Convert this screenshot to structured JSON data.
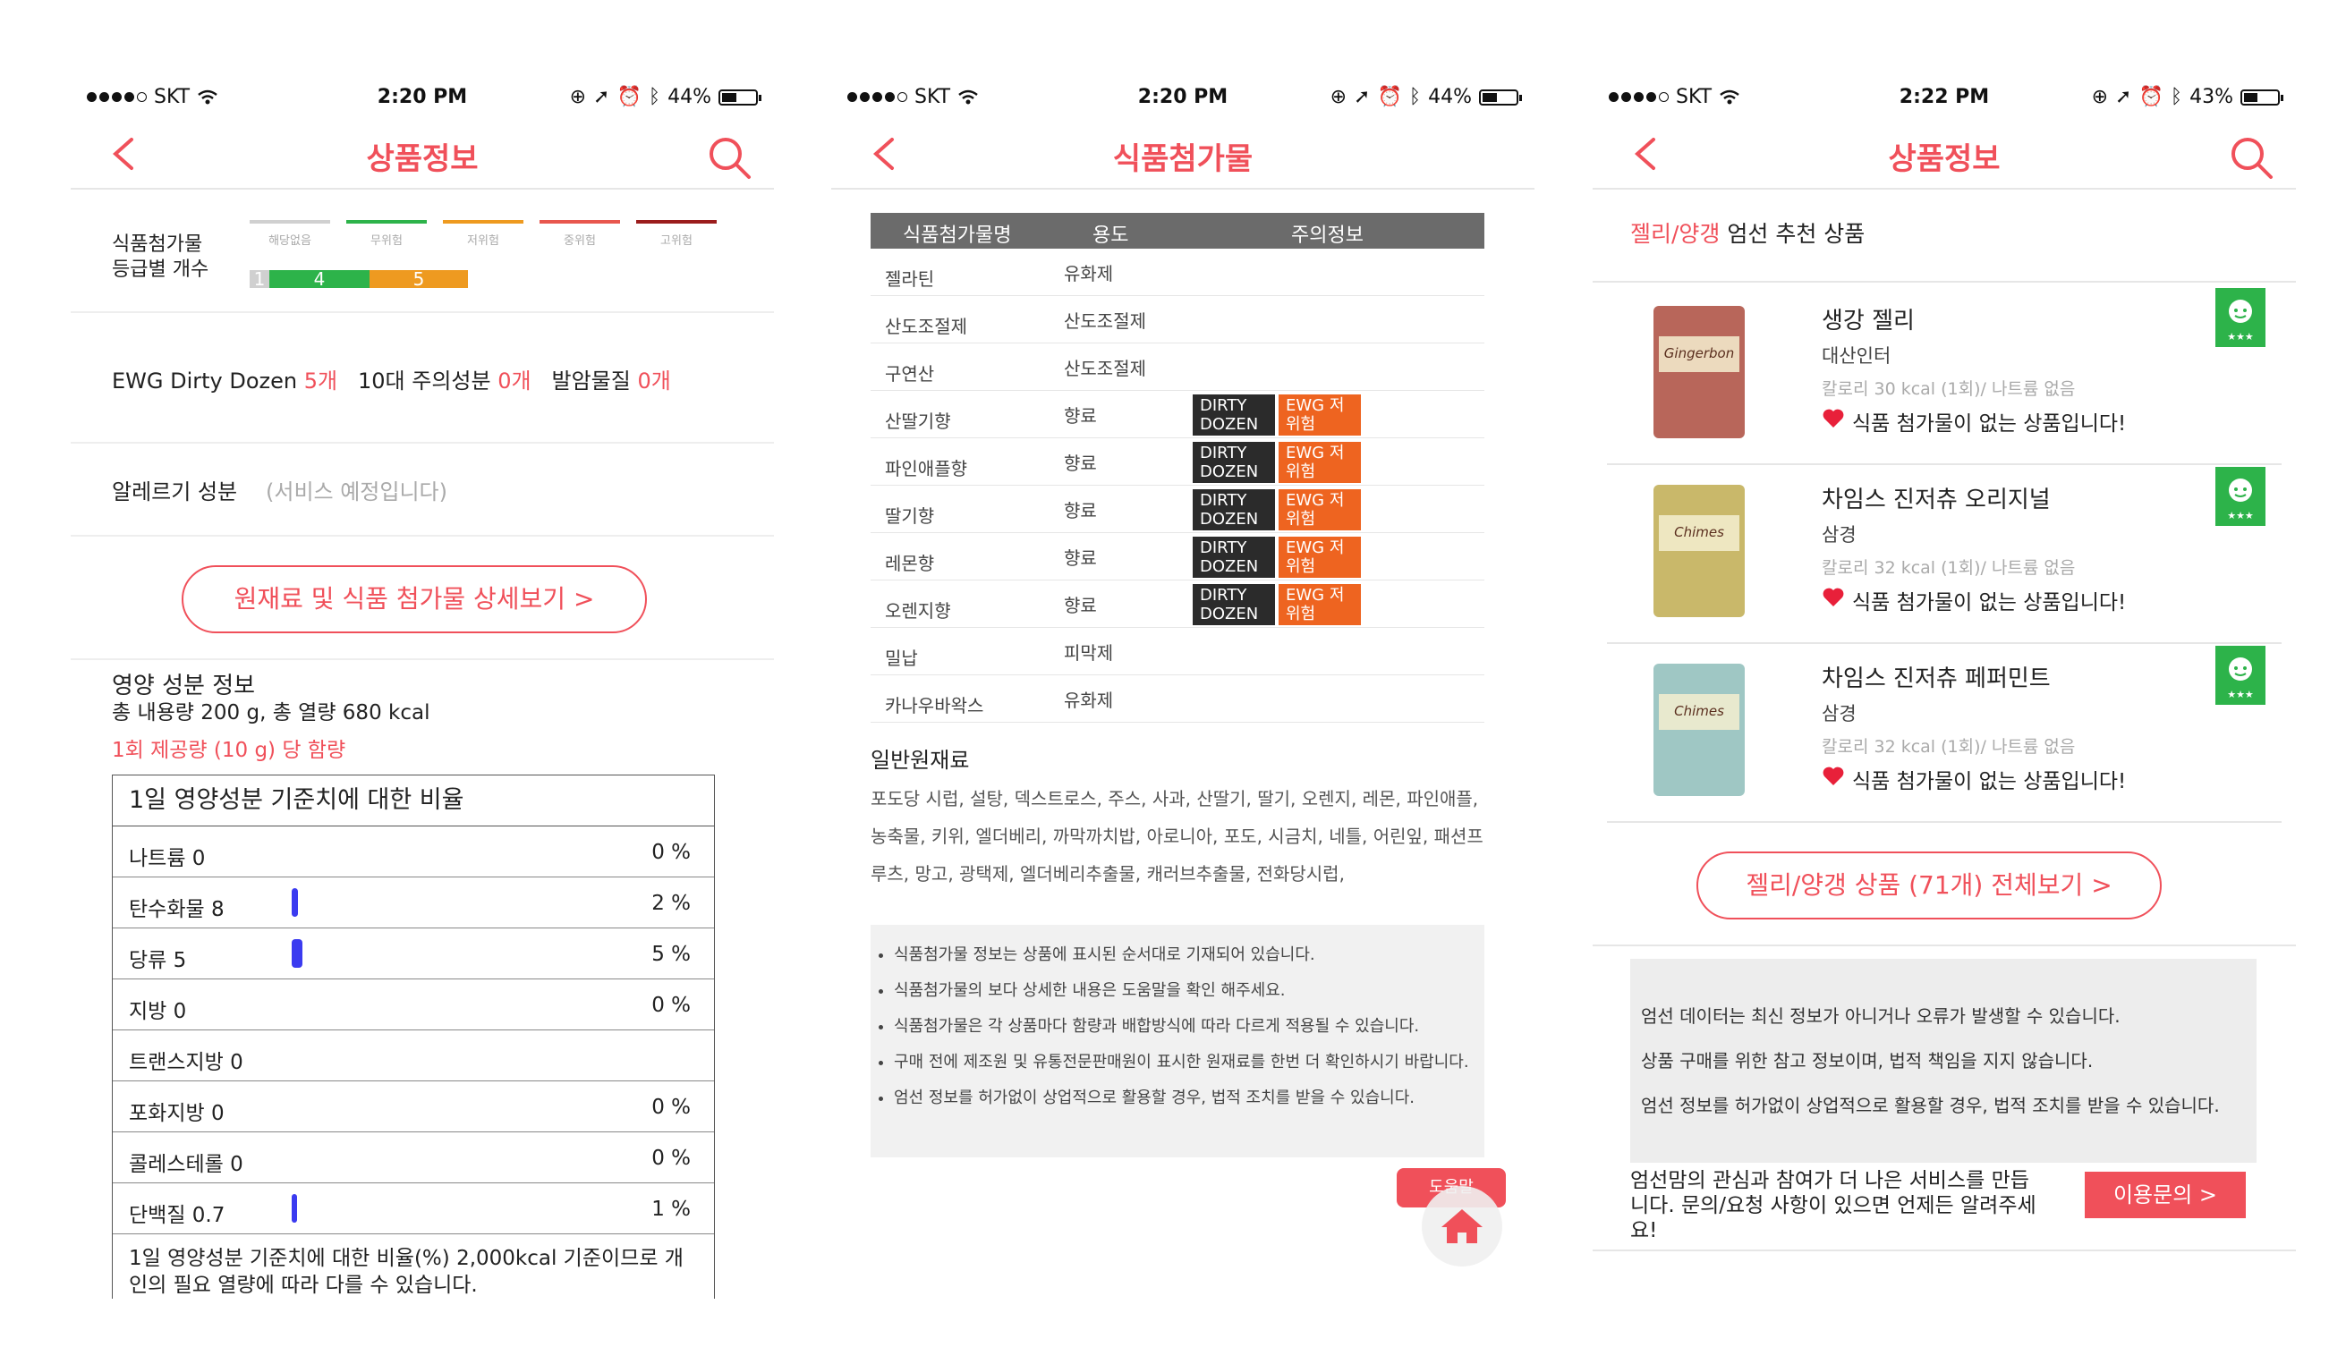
{
  "screens": [
    {
      "status": {
        "carrier": "SKT",
        "time": "2:20 PM",
        "battery": "44%",
        "battery_level": 0.44
      },
      "nav": {
        "title": "상품정보"
      },
      "grades": {
        "label_line1": "식품첨가물",
        "label_line2": "등급별 개수",
        "levels": [
          {
            "name": "해당없음",
            "color": "#d0d0d0"
          },
          {
            "name": "무위험",
            "color": "#2db34a"
          },
          {
            "name": "저위험",
            "color": "#ee9a20"
          },
          {
            "name": "중위험",
            "color": "#e8574e"
          },
          {
            "name": "고위험",
            "color": "#9b1c1c"
          }
        ],
        "counts": [
          {
            "value": "1",
            "color": "#d0d0d0"
          },
          {
            "value": "4",
            "color": "#2db34a"
          },
          {
            "value": "5",
            "color": "#ee9a20"
          }
        ]
      },
      "ewg": {
        "dirty_label": "EWG Dirty Dozen",
        "dirty_count": "5개",
        "caution_label": "10대 주의성분",
        "caution_count": "0개",
        "carcinogen_label": "발암물질",
        "carcinogen_count": "0개"
      },
      "allergy": {
        "label": "알레르기 성분",
        "value": "(서비스 예정입니다)"
      },
      "detail_button": "원재료 및 식품 첨가물 상세보기 >",
      "nutrition": {
        "title": "영양 성분 정보",
        "total": "총 내용량 200 g, 총 열량 680 kcal",
        "serving": "1회 제공량 (10 g) 당 함량",
        "table_header": "1일 영양성분 기준치에 대한 비율",
        "rows": [
          {
            "name": "나트륨 0",
            "percent": "0 %",
            "value": 0
          },
          {
            "name": "탄수화물 8",
            "percent": "2 %",
            "value": 2
          },
          {
            "name": "당류 5",
            "percent": "5 %",
            "value": 5
          },
          {
            "name": "지방 0",
            "percent": "0 %",
            "value": 0
          },
          {
            "name": "트랜스지방 0",
            "percent": "",
            "value": 0
          },
          {
            "name": "포화지방 0",
            "percent": "0 %",
            "value": 0
          },
          {
            "name": "콜레스테롤 0",
            "percent": "0 %",
            "value": 0
          },
          {
            "name": "단백질 0.7",
            "percent": "1 %",
            "value": 1
          }
        ],
        "footnote": "1일 영양성분 기준치에 대한 비율(%) 2,000kcal 기준이므로 개인의 필요 열량에 따라 다를 수 있습니다."
      }
    },
    {
      "status": {
        "carrier": "SKT",
        "time": "2:20 PM",
        "battery": "44%",
        "battery_level": 0.44
      },
      "nav": {
        "title": "식품첨가물"
      },
      "table": {
        "headers": [
          "식품첨가물명",
          "용도",
          "주의정보"
        ],
        "rows": [
          {
            "name": "젤라틴",
            "use": "유화제",
            "dirty": "",
            "ewg": ""
          },
          {
            "name": "산도조절제",
            "use": "산도조절제",
            "dirty": "",
            "ewg": ""
          },
          {
            "name": "구연산",
            "use": "산도조절제",
            "dirty": "",
            "ewg": ""
          },
          {
            "name": "산딸기향",
            "use": "향료",
            "dirty": "DIRTY DOZEN",
            "ewg": "EWG 저위험"
          },
          {
            "name": "파인애플향",
            "use": "향료",
            "dirty": "DIRTY DOZEN",
            "ewg": "EWG 저위험"
          },
          {
            "name": "딸기향",
            "use": "향료",
            "dirty": "DIRTY DOZEN",
            "ewg": "EWG 저위험"
          },
          {
            "name": "레몬향",
            "use": "향료",
            "dirty": "DIRTY DOZEN",
            "ewg": "EWG 저위험"
          },
          {
            "name": "오렌지향",
            "use": "향료",
            "dirty": "DIRTY DOZEN",
            "ewg": "EWG 저위험"
          },
          {
            "name": "밀납",
            "use": "피막제",
            "dirty": "",
            "ewg": ""
          },
          {
            "name": "카나우바왁스",
            "use": "유화제",
            "dirty": "",
            "ewg": ""
          }
        ]
      },
      "raw_title": "일반원재료",
      "raw_text": "포도당 시럽, 설탕, 덱스트로스, 주스, 사과, 산딸기, 딸기, 오렌지, 레몬, 파인애플, 농축물, 키위, 엘더베리, 까막까치밥, 아로니아, 포도, 시금치, 네틀, 어린잎, 패션프루츠, 망고, 광택제, 엘더베리추출물, 캐러브추출물, 전화당시럽,",
      "notes": [
        "식품첨가물 정보는 상품에 표시된 순서대로 기재되어 있습니다.",
        "식품첨가물의 보다 상세한 내용은 도움말을 확인 해주세요.",
        "식품첨가물은 각 상품마다 함량과 배합방식에 따라 다르게 적용될 수 있습니다.",
        "구매 전에 제조원 및 유통전문판매원이 표시한 원재료를 한번 더 확인하시기 바랍니다.",
        "엄선 정보를 허가없이 상업적으로 활용할 경우, 법적 조치를 받을 수 있습니다."
      ],
      "help_label": "도움말"
    },
    {
      "status": {
        "carrier": "SKT",
        "time": "2:22 PM",
        "battery": "43%",
        "battery_level": 0.43
      },
      "nav": {
        "title": "상품정보"
      },
      "rec": {
        "category": "젤리/양갱",
        "suffix": " 엄선 추천 상품"
      },
      "products": [
        {
          "name": "생강 젤리",
          "brand": "대산인터",
          "cal": "칼로리 30 kcal (1회)/ 나트륨 없음",
          "no_additive": "식품 첨가물이 없는 상품입니다!",
          "pack_label": "Gingerbon",
          "pack_color": "#b8665a"
        },
        {
          "name": "차임스 진저츄 오리지널",
          "brand": "삼경",
          "cal": "칼로리 32 kcal (1회)/ 나트륨 없음",
          "no_additive": "식품 첨가물이 없는 상품입니다!",
          "pack_label": "Chimes",
          "pack_color": "#c9b86a"
        },
        {
          "name": "차임스 진저츄 페퍼민트",
          "brand": "삼경",
          "cal": "칼로리 32 kcal (1회)/ 나트륨 없음",
          "no_additive": "식품 첨가물이 없는 상품입니다!",
          "pack_label": "Chimes",
          "pack_color": "#9fc7c4"
        }
      ],
      "all_button": "젤리/양갱 상품 (71개) 전체보기 >",
      "disclaimer": [
        "엄선 데이터는 최신 정보가 아니거나 오류가 발생할 수 있습니다.",
        "상품 구매를 위한 참고 정보이며, 법적 책임을 지지 않습니다.",
        "엄선 정보를 허가없이 상업적으로 활용할 경우, 법적 조치를 받을 수 있습니다."
      ],
      "contact_text": "엄선맘의 관심과 참여가 더 나은 서비스를 만듭니다. 문의/요청 사항이 있으면 언제든 알려주세요!",
      "inquiry_button": "이용문의 >"
    }
  ]
}
